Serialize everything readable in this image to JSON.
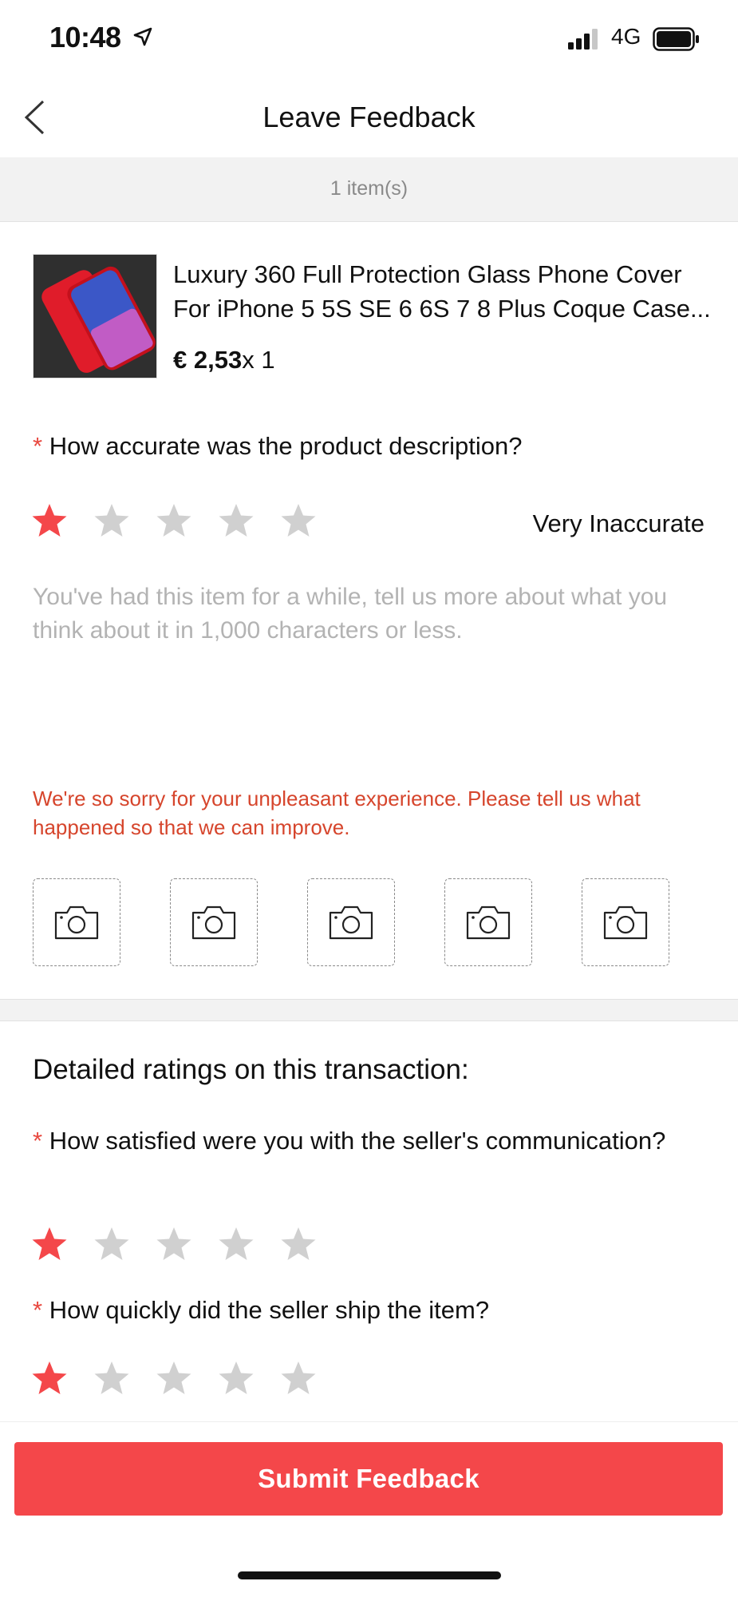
{
  "status_bar": {
    "time": "10:48",
    "network": "4G"
  },
  "nav": {
    "title": "Leave Feedback"
  },
  "items": {
    "count_label": "1 item(s)"
  },
  "product": {
    "title": "Luxury 360 Full Protection Glass Phone Cover For iPhone 5 5S SE 6 6S 7 8 Plus Coque Case...",
    "price": "€ 2,53",
    "quantity": "x 1"
  },
  "q_description": {
    "required_mark": "*",
    "question": "How accurate was the product description?",
    "rating": 1,
    "max_rating": 5,
    "rating_text": "Very Inaccurate"
  },
  "review": {
    "placeholder": "You've had this item for a while, tell us more about what you think about it in 1,000 characters or less.",
    "value": ""
  },
  "sorry_message": "We're so sorry for your unpleasant experience. Please tell us what happened so that we can improve.",
  "photo_slots": 5,
  "detailed": {
    "heading": "Detailed ratings on this transaction:",
    "questions": [
      {
        "required_mark": "*",
        "question": "How satisfied were you with the seller's communication?",
        "rating": 1,
        "max_rating": 5
      },
      {
        "required_mark": "*",
        "question": "How quickly did the seller ship the item?",
        "rating": 1,
        "max_rating": 5
      }
    ]
  },
  "submit": {
    "label": "Submit Feedback"
  },
  "colors": {
    "accent": "#f4474a",
    "star_on": "#f4474a",
    "star_off": "#d0d0d0",
    "warning": "#d6452c"
  },
  "icons": [
    "location-arrow-icon",
    "signal-icon",
    "battery-icon",
    "back-chevron-icon",
    "star-icon",
    "camera-icon"
  ]
}
